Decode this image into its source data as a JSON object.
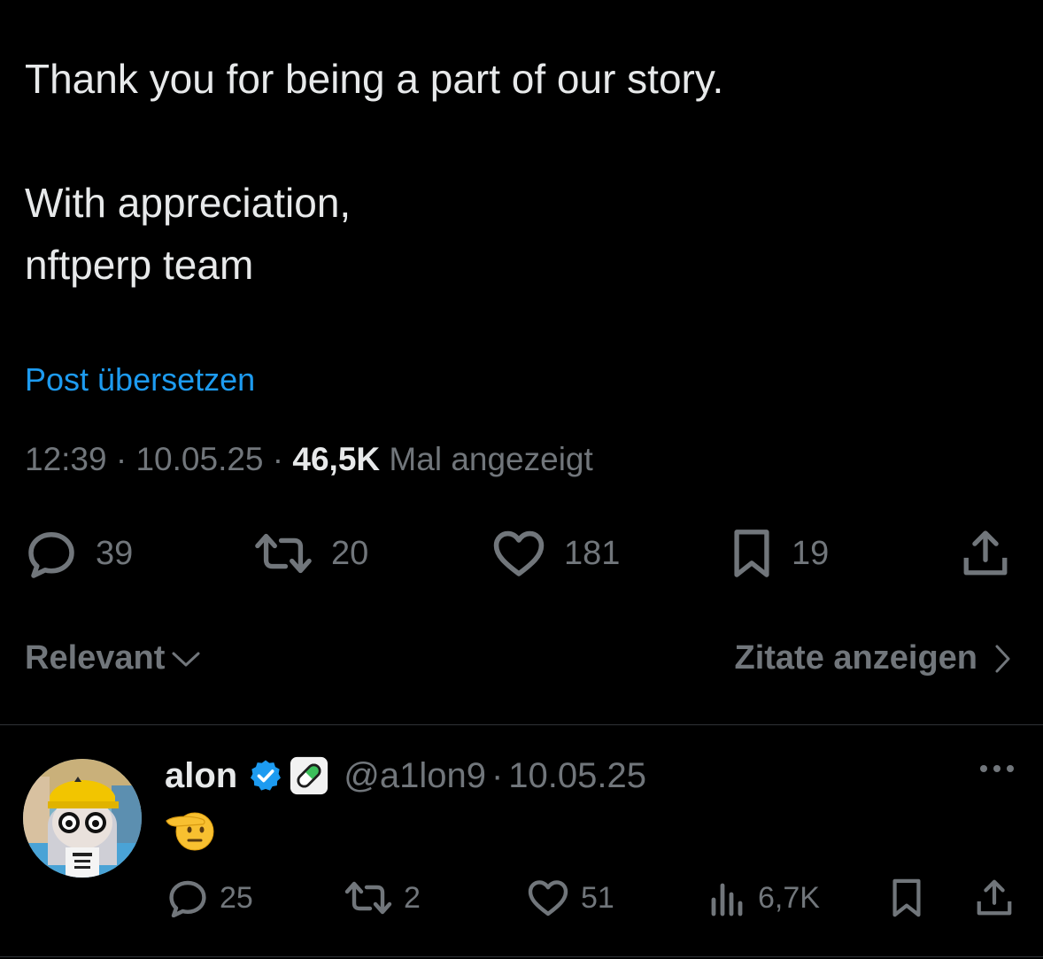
{
  "post": {
    "lines": [
      "Thank you for being a part of our story.",
      "",
      "With appreciation,",
      "nftperp team"
    ],
    "translate_label": "Post übersetzen",
    "time": "12:39",
    "date": "10.05.25",
    "views_count": "46,5K",
    "views_label": "Mal angezeigt",
    "actions": {
      "replies": "39",
      "reposts": "20",
      "likes": "181",
      "bookmarks": "19"
    }
  },
  "sort": {
    "label": "Relevant",
    "quotes_label": "Zitate anzeigen"
  },
  "reply": {
    "name": "alon",
    "handle": "@a1lon9",
    "date": "10.05.25",
    "emoji": "🫡",
    "actions": {
      "replies": "25",
      "reposts": "2",
      "likes": "51",
      "views": "6,7K"
    }
  },
  "colors": {
    "background": "#000000",
    "text": "#e7e9ea",
    "muted": "#71767b",
    "link": "#1d9bf0",
    "verified": "#1d9bf0"
  }
}
